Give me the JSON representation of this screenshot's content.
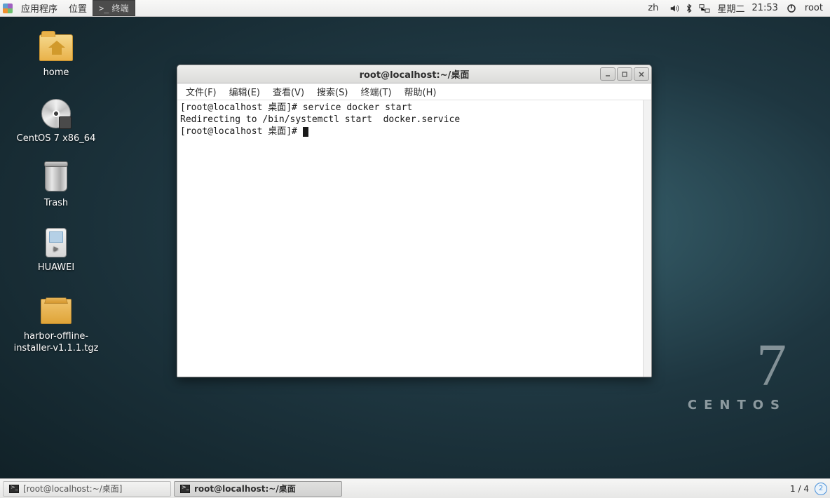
{
  "top_panel": {
    "apps": "应用程序",
    "places": "位置",
    "task_terminal": "终端",
    "lang": "zh",
    "date": "星期二",
    "time": "21:53",
    "user": "root"
  },
  "desktop": {
    "home": "home",
    "disc": "CentOS 7 x86_64",
    "trash": "Trash",
    "huawei": "HUAWEI",
    "harbor": "harbor-offline-installer-v1.1.1.tgz"
  },
  "window": {
    "title": "root@localhost:~/桌面",
    "menus": {
      "file": "文件(F)",
      "edit": "编辑(E)",
      "view": "查看(V)",
      "search": "搜索(S)",
      "terminal": "终端(T)",
      "help": "帮助(H)"
    },
    "line1": "[root@localhost 桌面]# service docker start",
    "line2": "Redirecting to /bin/systemctl start  docker.service",
    "line3": "[root@localhost 桌面]# "
  },
  "branding": {
    "seven": "7",
    "name": "CENTOS"
  },
  "bottom_panel": {
    "task1": "[root@localhost:~/桌面]",
    "task2": "root@localhost:~/桌面",
    "workspace": "1 / 4",
    "ws_num": "2"
  }
}
